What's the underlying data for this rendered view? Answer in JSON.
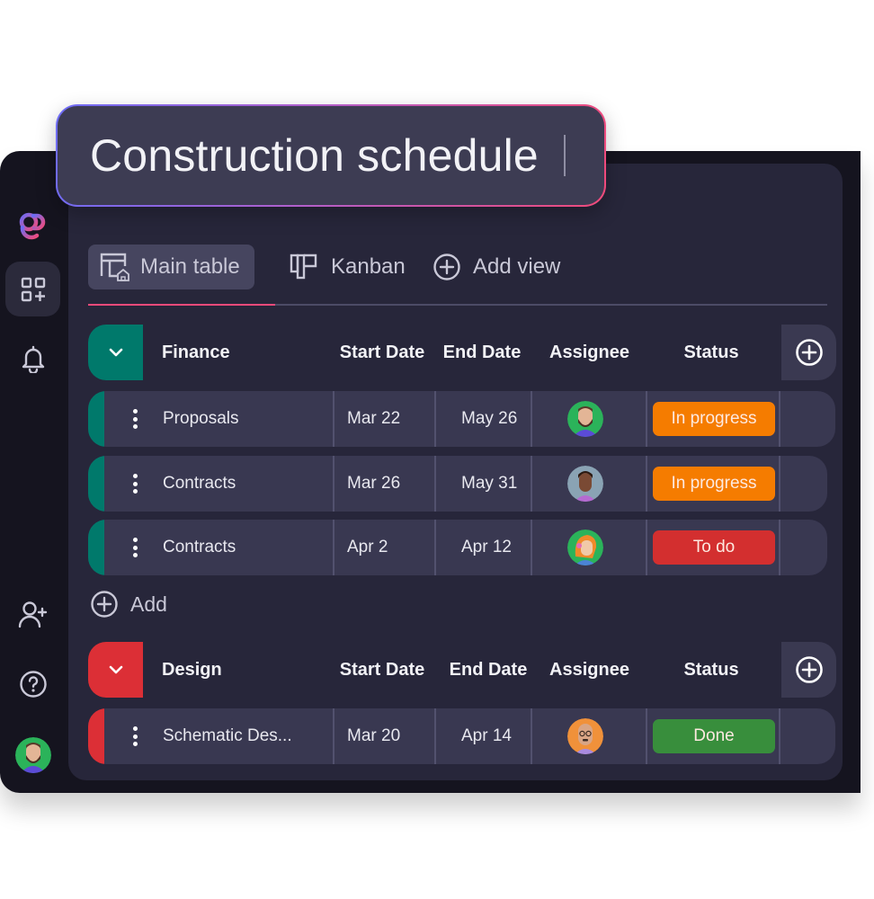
{
  "board_title": "Construction schedule",
  "sidebar": {
    "items": [
      {
        "name": "logo",
        "icon": "brand-logo"
      },
      {
        "name": "apps",
        "icon": "add-widget-icon",
        "active": true
      },
      {
        "name": "notifications",
        "icon": "bell-icon"
      },
      {
        "name": "invite",
        "icon": "add-user-icon"
      },
      {
        "name": "help",
        "icon": "help-icon"
      },
      {
        "name": "profile",
        "icon": "user-avatar"
      }
    ]
  },
  "tabs": [
    {
      "label": "Main table",
      "icon": "table-home-icon",
      "active": true
    },
    {
      "label": "Kanban",
      "icon": "kanban-icon",
      "active": false
    },
    {
      "label": "Add view",
      "icon": "plus-circle-icon",
      "active": false
    }
  ],
  "columns": [
    "Start Date",
    "End Date",
    "Assignee",
    "Status"
  ],
  "colors": {
    "accent": "#f04a7a",
    "finance": "#00796b",
    "design": "#dc2f36",
    "in_progress": "#f57c00",
    "to_do": "#d32f2f",
    "done": "#388e3c"
  },
  "groups": [
    {
      "name": "Finance",
      "color": "#00796b",
      "rows": [
        {
          "task": "Proposals",
          "start": "Mar 22",
          "end": "May 26",
          "assignee": "bearded-man-avatar",
          "status": "In progress",
          "status_color": "#f57c00"
        },
        {
          "task": "Contracts",
          "start": "Mar 26",
          "end": "May 31",
          "assignee": "man-avatar",
          "status": "In progress",
          "status_color": "#f57c00"
        },
        {
          "task": "Contracts",
          "start": "Apr 2",
          "end": "Apr 12",
          "assignee": "woman-headset-avatar",
          "status": "To do",
          "status_color": "#d32f2f"
        }
      ],
      "add_label": "Add"
    },
    {
      "name": "Design",
      "color": "#dc2f36",
      "rows": [
        {
          "task": "Schematic Des...",
          "start": "Mar 20",
          "end": "Apr 14",
          "assignee": "bald-man-avatar",
          "status": "Done",
          "status_color": "#388e3c"
        }
      ]
    }
  ]
}
